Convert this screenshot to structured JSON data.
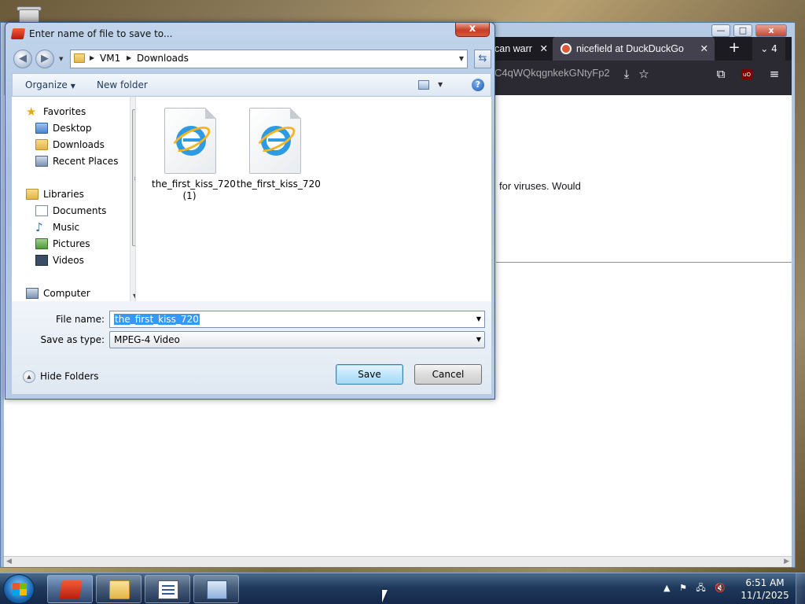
{
  "dialog": {
    "title": "Enter name of file to save to...",
    "close_label": "x",
    "breadcrumb": [
      "VM1",
      "Downloads"
    ],
    "toolbar": {
      "organize": "Organize",
      "new_folder": "New folder",
      "help": "?"
    },
    "nav": {
      "favorites": "Favorites",
      "favorites_items": [
        "Desktop",
        "Downloads",
        "Recent Places"
      ],
      "libraries": "Libraries",
      "libraries_items": [
        "Documents",
        "Music",
        "Pictures",
        "Videos"
      ],
      "computer": "Computer"
    },
    "files": [
      {
        "name_line1": "the_first_kiss_720",
        "name_line2": "(1)"
      },
      {
        "name_line1": "the_first_kiss_720",
        "name_line2": ""
      }
    ],
    "file_name_label": "File name:",
    "file_name_value": "the_first_kiss_720",
    "save_as_type_label": "Save as type:",
    "save_as_type_value": "MPEG-4 Video",
    "hide_folders": "Hide Folders",
    "save_button": "Save",
    "cancel_button": "Cancel"
  },
  "browser": {
    "tab1_title": "can warr",
    "tab2_title": "nicefield at DuckDuckGo",
    "tab_count": "4",
    "url_fragment": "C4qWQkqgnkekGNtyFp2",
    "content_fragment": "for viruses. Would",
    "window_controls": {
      "min": "—",
      "max": "□",
      "close": "x"
    }
  },
  "taskbar": {
    "time": "6:51 AM",
    "date": "11/1/2025"
  }
}
